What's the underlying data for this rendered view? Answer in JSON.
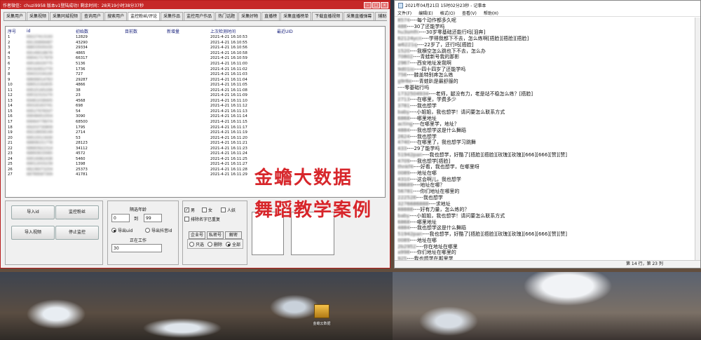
{
  "app": {
    "title": "作者微信：chuzi9958 版本v1登陆成功! 剩余时间：28天19小时38分37秒",
    "tabs": [
      "采集用户",
      "采集视频",
      "采集同城视频",
      "查询用户",
      "搜索用户",
      "监控粉丝/评论",
      "采集作品",
      "监控用户作品",
      "热门话题",
      "采集好物",
      "直播榜",
      "采集直播榜单",
      "下载直播视频",
      "采集直播弹幕",
      "辅助功能"
    ],
    "active_tab": 5,
    "columns": [
      "序号",
      "id",
      "初始数",
      "目前数",
      "新增量",
      "上次检测时间",
      "最近UID"
    ],
    "rows": [
      [
        "1",
        "69227413193",
        "12829",
        "2021-4-21 16:10:53"
      ],
      [
        "2",
        "69130899487",
        "43290",
        "2021-4-21 16:10:55"
      ],
      [
        "3",
        "68833505035",
        "29334",
        "2021-4-21 16:10:56"
      ],
      [
        "4",
        "69149018676",
        "4865",
        "2021-4-21 16:10:58"
      ],
      [
        "5",
        "69041717979",
        "66317",
        "2021-4-21 16:10:59"
      ],
      [
        "6",
        "69516029775",
        "5136",
        "2021-4-21 16:11:00"
      ],
      [
        "7",
        "69192652770",
        "1736",
        "2021-4-21 16:11:02"
      ],
      [
        "8",
        "69431534100",
        "727",
        "2021-4-21 16:11:03"
      ],
      [
        "9",
        "68699014763",
        "29287",
        "2021-4-21 16:11:04"
      ],
      [
        "10",
        "68652192835",
        "4866",
        "2021-4-21 16:11:05"
      ],
      [
        "11",
        "69525165206",
        "38",
        "2021-4-21 16:11:08"
      ],
      [
        "12",
        "69532315270",
        "23",
        "2021-4-21 16:11:09"
      ],
      [
        "13",
        "69461038405",
        "4568",
        "2021-4-21 16:11:10"
      ],
      [
        "14",
        "69316163741",
        "698",
        "2021-4-21 16:11:12"
      ],
      [
        "15",
        "69527976507",
        "54",
        "2021-4-21 16:11:13"
      ],
      [
        "16",
        "69048452054",
        "3090",
        "2021-4-21 16:11:14"
      ],
      [
        "17",
        "69064778074",
        "68500",
        "2021-4-21 16:11:15"
      ],
      [
        "18",
        "69203730809",
        "1795",
        "2021-4-21 16:11:17"
      ],
      [
        "19",
        "69218658149",
        "2714",
        "2021-4-21 16:11:19"
      ],
      [
        "20",
        "69515513430",
        "53",
        "2021-4-21 16:11:20"
      ],
      [
        "21",
        "68808151778",
        "28123",
        "2021-4-21 16:11:21"
      ],
      [
        "22",
        "68683922314",
        "34112",
        "2021-4-21 16:11:23"
      ],
      [
        "23",
        "68893633065",
        "4572",
        "2021-4-21 16:11:24"
      ],
      [
        "24",
        "69516962436",
        "5460",
        "2021-4-21 16:11:25"
      ],
      [
        "25",
        "69012033239",
        "1398",
        "2021-4-21 16:11:27"
      ],
      [
        "26",
        "68236073254",
        "25373",
        "2021-4-21 16:11:28"
      ],
      [
        "27",
        "68789587309",
        "41781",
        "2021-4-21 16:11:29"
      ]
    ],
    "buttons": {
      "import_id": "导入id",
      "monitor_fans": "监控粉丝",
      "import_video": "导入视频",
      "stop_monitor": "停止监控"
    },
    "interval_label": "隔选年龄",
    "age_from": "0",
    "age_to_label": "到",
    "age_to": "99",
    "export_uid": "导出uid",
    "export_douyin": "导出抖音id",
    "working_label": "正在工作",
    "working_value": "30",
    "gender": [
      "男",
      "女",
      "人妖"
    ],
    "exclude_repeat": "排除名字已重复",
    "group_tabs": [
      "企业号",
      "私密号",
      "解密"
    ],
    "radio_opts": [
      "只选",
      "删除",
      "全部"
    ]
  },
  "notepad": {
    "title": "2021年04月21日 15时02分23秒 - 记事本",
    "menu": [
      "文件(F)",
      "编辑(E)",
      "格式(O)",
      "查看(V)",
      "帮助(H)"
    ],
    "status": "第 14 行，第 23 列",
    "lines": [
      [
        "8574",
        "----每个动作都多久呢"
      ],
      [
        "488",
        "----30了还能学吗"
      ],
      [
        "hu3smfn",
        "----30岁零基础还能行吗[泪奔]"
      ],
      [
        "62124ycn",
        "----学得我都下不去，怎么练啊[捂脸][捂脸][捂脸]"
      ],
      [
        "w6221q",
        "----22岁了，还行吗[捂脸]"
      ],
      [
        "1520",
        "----我横空怎么跳也下不去，怎么办"
      ],
      [
        "70802",
        "----青蛙新号我的那影"
      ],
      [
        "2967",
        "----西安地址发我啊"
      ],
      [
        "9d01io",
        "----四十四岁了还能学吗"
      ],
      [
        "756",
        "----膝盖特别疼怎么练"
      ],
      [
        "g9r6e",
        "----青蛙趴是最舒服的"
      ],
      [
        "",
        "----零基础行吗"
      ],
      [
        "1732504934",
        "----老师，腿没有力，老是站不稳怎么练？[捂脸]"
      ],
      [
        "2713",
        "----在哪里，学费多少"
      ],
      [
        "3781",
        "----我也想学"
      ],
      [
        "baby",
        "----小姐姐，我也想学！请问要怎么联系方式"
      ],
      [
        "6868",
        "----哪里地址"
      ],
      [
        "acting",
        "----在哪里学，地址？"
      ],
      [
        "4884",
        "----我也想学这是什么舞蹈"
      ],
      [
        "2624",
        "----我也想学"
      ],
      [
        "4740",
        "----在哪里了，我也想学习跳舞"
      ],
      [
        "433",
        "----29了能学吗"
      ],
      [
        "51942pan",
        "----我也想学，好酷了[捂脸][捂脸][玫瑰][玫瑰][666][666][赞][赞]"
      ],
      [
        "4709",
        "----我也想学[捂脸]"
      ],
      [
        "thnkf4",
        "----好看，我也想学，在哪里呀"
      ],
      [
        "0089",
        "----地址在哪"
      ],
      [
        "4310",
        "----这会啊儿，我也想学"
      ],
      [
        "98689",
        "----地址在哪？"
      ],
      [
        "56781",
        "----你们地址在哪里的"
      ],
      [
        "222528",
        "----我也想学"
      ],
      [
        "3276686888",
        "----求地址"
      ],
      [
        "88888",
        "----好有力量，怎么练的？"
      ],
      [
        "baby",
        "----小姐姐，我也想学！请问要怎么联系方式"
      ],
      [
        "6868",
        "----哪里地址"
      ],
      [
        "4884",
        "----我也想学这是什么舞蹈"
      ],
      [
        "51942pan",
        "----我也想学，好酷了[捂脸][捂脸][玫瑰][玫瑰][666][666][赞][赞]"
      ],
      [
        "0089",
        "----地址在哪"
      ],
      [
        "2b2952",
        "----你在地址在哪里"
      ],
      [
        "a998",
        "----你们地址在哪里的"
      ],
      [
        "925",
        "----我也想学在那里学"
      ]
    ]
  },
  "overlay": {
    "line1": "金蟾大数据",
    "line2": "舞蹈教学案例"
  },
  "desktop": {
    "icon_label": "金蟾云数据"
  }
}
